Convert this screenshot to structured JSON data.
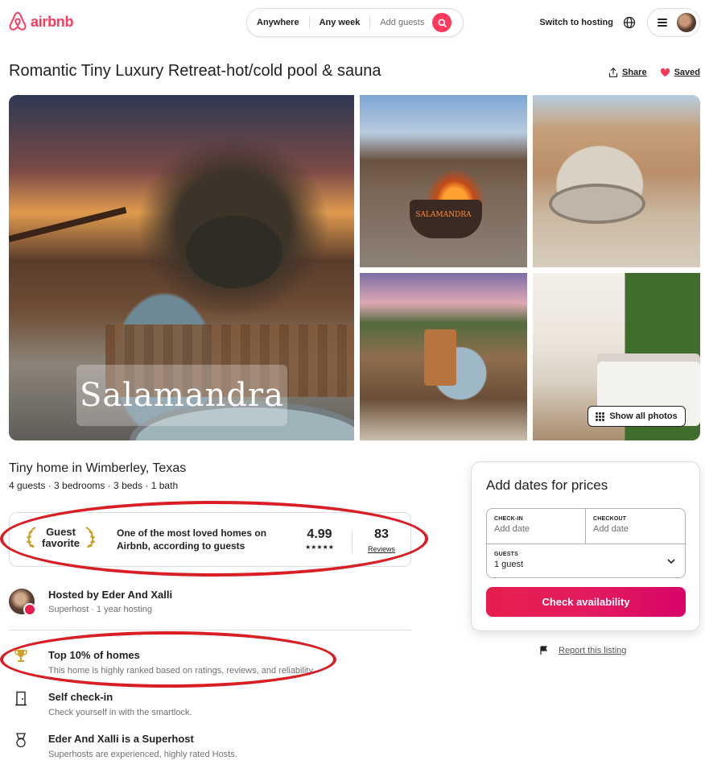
{
  "header": {
    "logo_text": "airbnb",
    "search": {
      "where": "Anywhere",
      "when": "Any week",
      "guests": "Add guests"
    },
    "switch_hosting": "Switch to hosting"
  },
  "listing": {
    "title": "Romantic Tiny Luxury Retreat-hot/cold pool & sauna",
    "share_label": "Share",
    "saved_label": "Saved",
    "photo_sign_text": "Salamandra",
    "firepit_text": "SALAMANDRA",
    "show_all_photos": "Show all photos",
    "subtitle": "Tiny home in Wimberley, Texas",
    "details": "4 guests · 3 bedrooms · 3 beds · 1 bath"
  },
  "guest_favorite": {
    "badge_line1": "Guest",
    "badge_line2": "favorite",
    "description": "One of the most loved homes on Airbnb, according to guests",
    "rating": "4.99",
    "stars": "★★★★★",
    "reviews_count": "83",
    "reviews_label": "Reviews"
  },
  "host": {
    "title": "Hosted by Eder And Xalli",
    "subtitle": "Superhost · 1 year hosting"
  },
  "features": [
    {
      "icon": "trophy-icon",
      "title": "Top 10% of homes",
      "subtitle": "This home is highly ranked based on ratings, reviews, and reliability."
    },
    {
      "icon": "door-icon",
      "title": "Self check-in",
      "subtitle": "Check yourself in with the smartlock."
    },
    {
      "icon": "medal-icon",
      "title": "Eder And Xalli is a Superhost",
      "subtitle": "Superhosts are experienced, highly rated Hosts."
    }
  ],
  "booking": {
    "title": "Add dates for prices",
    "checkin_label": "CHECK-IN",
    "checkin_value": "Add date",
    "checkout_label": "CHECKOUT",
    "checkout_value": "Add date",
    "guests_label": "GUESTS",
    "guests_value": "1 guest",
    "button": "Check availability"
  },
  "report_label": "Report this listing",
  "colors": {
    "brand": "#ff385c",
    "annotation_red": "#d81f26",
    "text": "#222222",
    "muted": "#717171"
  }
}
